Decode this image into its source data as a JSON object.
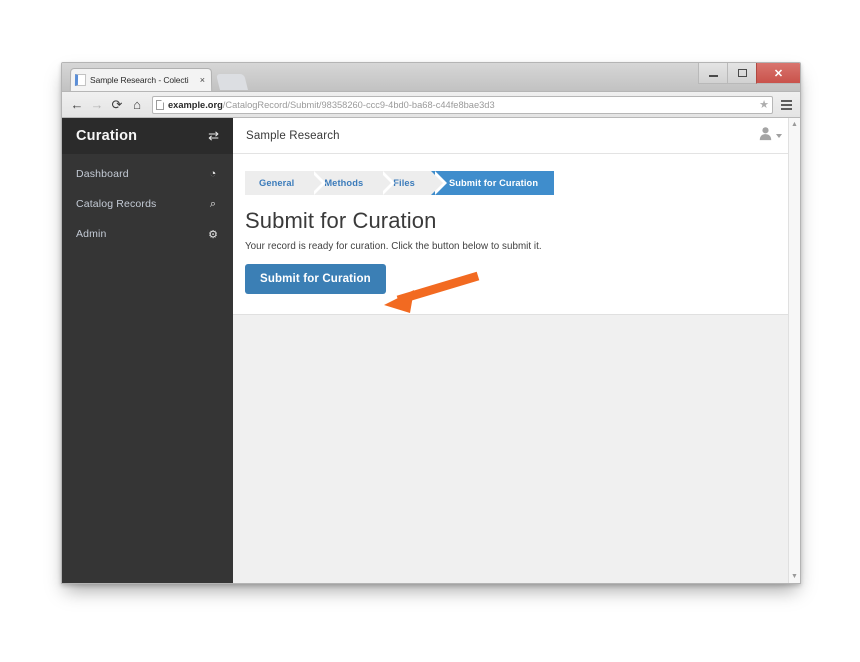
{
  "browser": {
    "tab": {
      "title": "Sample Research - Colecti",
      "favicon_icon": "document-favicon",
      "close_icon": "×"
    },
    "new_tab_name": "new-tab",
    "window_controls": {
      "minimize_label": "–",
      "maximize_label": "□",
      "close_label": "✕"
    },
    "toolbar": {
      "back_icon": "←",
      "forward_icon": "→",
      "reload_icon": "⟳",
      "home_icon": "⌂",
      "bookmark_icon": "★",
      "menu_icon": "hamburger-menu",
      "url_domain": "example.org",
      "url_path": "/CatalogRecord/Submit/98358260-ccc9-4bd0-ba68-c44fe8bae3d3",
      "url_full": "example.org/CatalogRecord/Submit/98358260-ccc9-4bd0-ba68-c44fe8bae3d3"
    }
  },
  "sidebar": {
    "brand": "Curation",
    "toggle_icon": "⇄",
    "items": [
      {
        "label": "Dashboard",
        "icon": "◔",
        "icon_name": "dashboard-dial-icon"
      },
      {
        "label": "Catalog Records",
        "icon": "⌕",
        "icon_name": "search-icon"
      },
      {
        "label": "Admin",
        "icon": "⚙",
        "icon_name": "gear-icon"
      }
    ]
  },
  "navbar": {
    "title": "Sample Research",
    "avatar_icon": "♟",
    "user_caret_icon": "caret-down"
  },
  "wizard": {
    "steps": [
      {
        "label": "General",
        "active": false
      },
      {
        "label": "Methods",
        "active": false
      },
      {
        "label": "Files",
        "active": false
      },
      {
        "label": "Submit for Curation",
        "active": true
      }
    ]
  },
  "main": {
    "heading": "Submit for Curation",
    "lead": "Your record is ready for curation. Click the button below to submit it.",
    "submit_button_label": "Submit for Curation"
  },
  "scrollbar": {
    "up_arrow": "▲",
    "down_arrow": "▼"
  },
  "annotation": {
    "arrow_color": "#f26a21",
    "arrow_name": "callout-arrow-pointing-to-submit-button"
  },
  "colors": {
    "sidebar_bg": "#353535",
    "sidebar_brand_bg": "#2b2b2b",
    "primary_blue": "#3b7fb5",
    "step_active_blue": "#3f8dcc",
    "step_inactive_bg": "#ededed",
    "page_bg": "#f0f0f0",
    "arrow_orange": "#f26a21"
  }
}
